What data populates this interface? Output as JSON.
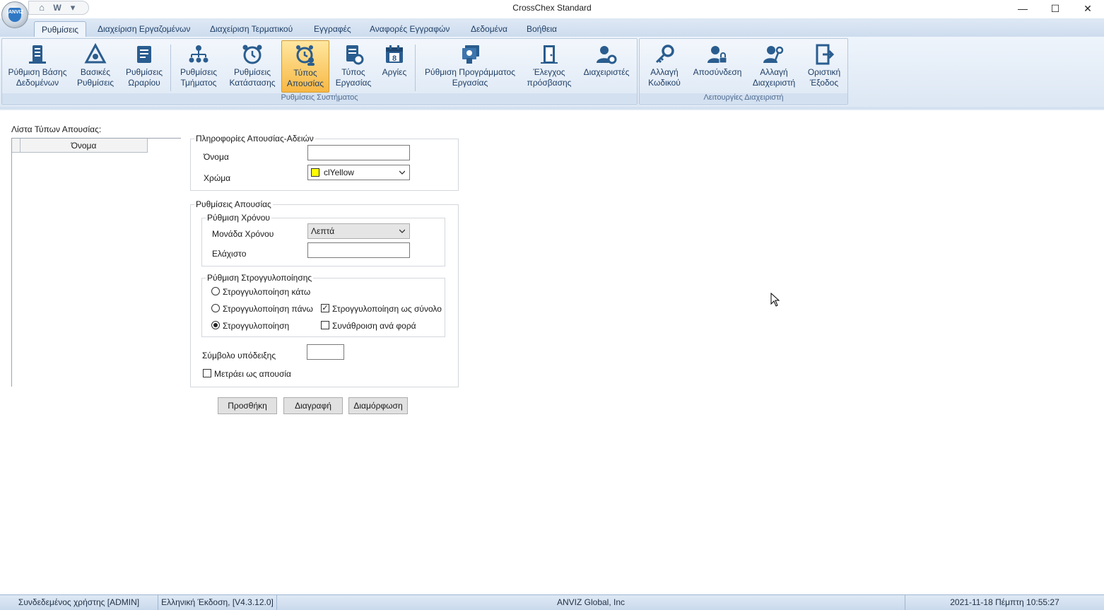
{
  "app": {
    "title": "CrossChex Standard",
    "logo_text": "ANVIZ"
  },
  "quick_access": [
    {
      "icon": "home-icon",
      "glyph": "⌂"
    },
    {
      "icon": "logo-w-icon",
      "glyph": "W"
    },
    {
      "icon": "dropdown-menu-icon",
      "glyph": "▾"
    }
  ],
  "window_controls": {
    "minimize": "—",
    "maximize": "☐",
    "close": "✕"
  },
  "tabs": [
    {
      "label": "Ρυθμίσεις",
      "active": true
    },
    {
      "label": "Διαχείριση Εργαζομένων",
      "active": false
    },
    {
      "label": "Διαχείριση Τερματικού",
      "active": false
    },
    {
      "label": "Εγγραφές",
      "active": false
    },
    {
      "label": "Αναφορές Εγγραφών",
      "active": false
    },
    {
      "label": "Δεδομένα",
      "active": false
    },
    {
      "label": "Βοήθεια",
      "active": false
    }
  ],
  "ribbon": {
    "system_group": {
      "label": "Ρυθμίσεις Συστήματος",
      "buttons": [
        {
          "line1": "Ρύθμιση Βάσης",
          "line2": "Δεδομένων",
          "icon": "database-server-icon"
        },
        {
          "line1": "Βασικές",
          "line2": "Ρυθμίσεις",
          "icon": "basic-settings-icon"
        },
        {
          "line1": "Ρυθμίσεις",
          "line2": "Ωραρίου",
          "icon": "schedule-icon"
        },
        {
          "line1": "Ρυθμίσεις",
          "line2": "Τμήματος",
          "icon": "department-tree-icon"
        },
        {
          "line1": "Ρυθμίσεις",
          "line2": "Κατάστασης",
          "icon": "alarm-clock-icon"
        },
        {
          "line1": "Τύπος",
          "line2": "Απουσίας",
          "icon": "absence-clock-icon",
          "active": true
        },
        {
          "line1": "Τύπος",
          "line2": "Εργασίας",
          "icon": "work-type-icon"
        },
        {
          "line1": "Αργίες",
          "line2": "",
          "icon": "calendar-icon",
          "calendar_day": "8"
        },
        {
          "line1": "Ρύθμιση Προγράμματος",
          "line2": "Εργασίας",
          "icon": "work-schedule-icon"
        },
        {
          "line1": "Έλεγχος",
          "line2": "πρόσβασης",
          "icon": "door-access-icon"
        },
        {
          "line1": "Διαχειριστές",
          "line2": "",
          "icon": "admin-user-gear-icon"
        }
      ]
    },
    "admin_group": {
      "label": "Λειτουργίες Διαχειριστή",
      "buttons": [
        {
          "line1": "Αλλαγή",
          "line2": "Κωδικού",
          "icon": "key-icon"
        },
        {
          "line1": "Αποσύνδεση",
          "line2": "",
          "icon": "user-lock-icon"
        },
        {
          "line1": "Αλλαγή",
          "line2": "Διαχειριστή",
          "icon": "user-key-icon"
        },
        {
          "line1": "Οριστική",
          "line2": "Έξοδος",
          "icon": "exit-door-icon"
        }
      ]
    }
  },
  "absence_list": {
    "label": "Λίστα Τύπων Απουσίας:",
    "column_header": "Όνομα",
    "rows": []
  },
  "info_group": {
    "legend": "Πληροφορίες Απουσίας-Αδειών",
    "name_label": "Όνομα",
    "name_value": "",
    "color_label": "Χρώμα",
    "color_value": "clYellow",
    "color_hex": "#ffff00"
  },
  "settings_group": {
    "legend": "Ρυθμίσεις Απουσίας",
    "time_group": {
      "legend": "Ρύθμιση Χρόνου",
      "unit_label": "Μονάδα Χρόνου",
      "unit_value": "Λεπτά",
      "min_label": "Ελάχιστο",
      "min_value": ""
    },
    "rounding_group": {
      "legend": "Ρύθμιση Στρογγυλοποίησης",
      "round_down": "Στρογγυλοποίηση κάτω",
      "round_up": "Στρογγυλοποίηση πάνω",
      "round": "Στρογγυλοποίηση",
      "round_total": "Στρογγυλοποίηση ως σύνολο",
      "sum_each": "Συνάθροιση ανά φορά",
      "selected": "round",
      "round_total_checked": true,
      "sum_each_checked": false
    },
    "symbol_label": "Σύμβολο υπόδειξης",
    "symbol_value": "",
    "counts_as_absence": "Μετράει ως απουσία",
    "counts_as_absence_checked": false
  },
  "actions": {
    "add": "Προσθήκη",
    "delete": "Διαγραφή",
    "configure": "Διαμόρφωση"
  },
  "status": {
    "user": "Συνδεδεμένος χρήστης [ADMIN]",
    "version": "Ελληνική Έκδοση, [V4.3.12.0]",
    "company": "ANVIZ Global, Inc",
    "datetime": "2021-11-18 Πέμπτη 10:55:27"
  }
}
